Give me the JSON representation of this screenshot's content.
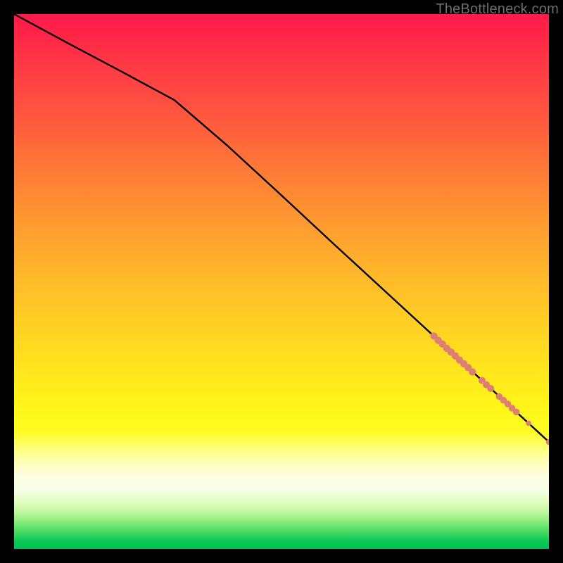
{
  "watermark": {
    "text": "TheBottleneck.com"
  },
  "colors": {
    "background": "#000000",
    "line": "#000000",
    "marker": "#de7f74",
    "gradient_top": "#ff1a4b",
    "gradient_bottom": "#00c154"
  },
  "chart_data": {
    "type": "line",
    "title": "",
    "xlabel": "",
    "ylabel": "",
    "xlim": [
      0,
      100
    ],
    "ylim": [
      0,
      100
    ],
    "grid": false,
    "series": [
      {
        "name": "curve",
        "x": [
          0,
          10,
          20,
          30,
          40,
          50,
          60,
          70,
          80,
          90,
          100
        ],
        "y": [
          100.0,
          94.6,
          89.3,
          83.9,
          75.3,
          66.1,
          56.8,
          47.6,
          38.4,
          29.2,
          20.0
        ]
      }
    ],
    "markers": [
      {
        "x": 78.5,
        "y": 39.8,
        "r": 5.2
      },
      {
        "x": 79.3,
        "y": 39.0,
        "r": 5.2
      },
      {
        "x": 80.1,
        "y": 38.3,
        "r": 5.2
      },
      {
        "x": 80.9,
        "y": 37.5,
        "r": 5.2
      },
      {
        "x": 81.7,
        "y": 36.8,
        "r": 5.2
      },
      {
        "x": 82.5,
        "y": 36.1,
        "r": 5.2
      },
      {
        "x": 83.3,
        "y": 35.3,
        "r": 5.2
      },
      {
        "x": 84.1,
        "y": 34.6,
        "r": 5.2
      },
      {
        "x": 84.9,
        "y": 33.9,
        "r": 5.2
      },
      {
        "x": 85.7,
        "y": 33.1,
        "r": 5.2
      },
      {
        "x": 87.5,
        "y": 31.5,
        "r": 5.0
      },
      {
        "x": 88.3,
        "y": 30.7,
        "r": 5.0
      },
      {
        "x": 89.1,
        "y": 30.0,
        "r": 5.0
      },
      {
        "x": 90.7,
        "y": 28.5,
        "r": 4.8
      },
      {
        "x": 91.5,
        "y": 27.8,
        "r": 4.8
      },
      {
        "x": 92.3,
        "y": 27.1,
        "r": 4.8
      },
      {
        "x": 93.1,
        "y": 26.3,
        "r": 4.8
      },
      {
        "x": 93.9,
        "y": 25.6,
        "r": 4.8
      },
      {
        "x": 96.2,
        "y": 23.5,
        "r": 3.8
      },
      {
        "x": 100.0,
        "y": 20.0,
        "r": 4.2
      }
    ]
  }
}
